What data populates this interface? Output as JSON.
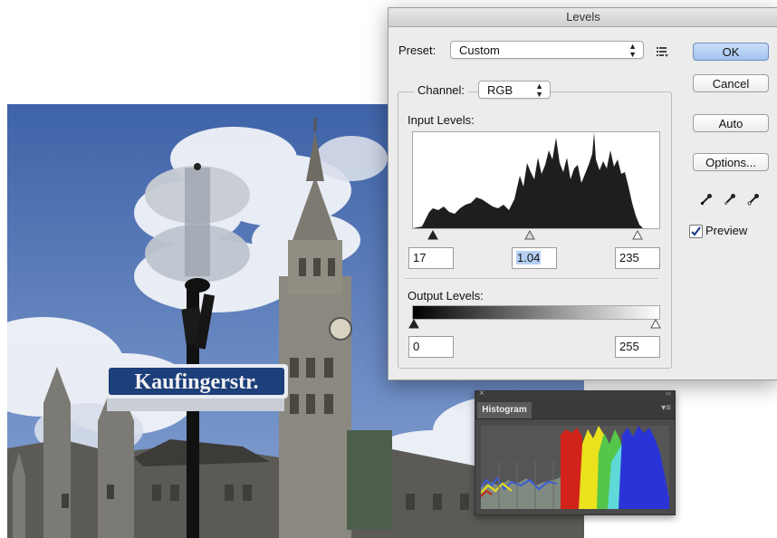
{
  "dialog": {
    "title": "Levels",
    "preset_label": "Preset:",
    "preset_value": "Custom",
    "channel_label": "Channel:",
    "channel_value": "RGB",
    "input_levels_label": "Input Levels:",
    "output_levels_label": "Output Levels:",
    "input_black": "17",
    "input_gamma": "1.04",
    "input_white": "235",
    "output_black": "0",
    "output_white": "255",
    "ok_label": "OK",
    "cancel_label": "Cancel",
    "auto_label": "Auto",
    "options_label": "Options...",
    "preview_label": "Preview",
    "preview_checked": true
  },
  "photo": {
    "street_sign_text": "Kaufingerstr."
  },
  "histogram_panel": {
    "tab_label": "Histogram"
  },
  "colors": {
    "ok_button": "#a8c8f0",
    "histogram_fill": "#2a2a2a",
    "sky": "#4f74b6"
  }
}
